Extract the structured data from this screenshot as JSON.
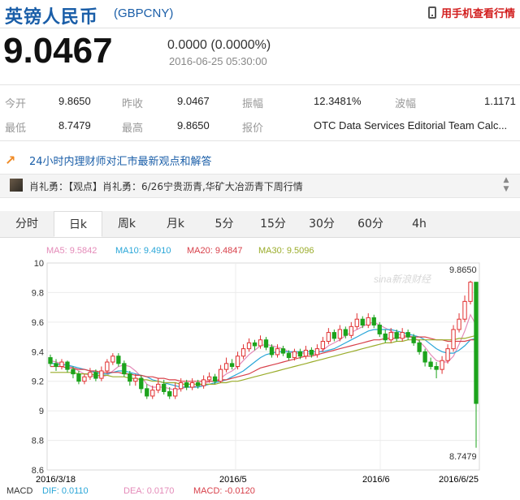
{
  "header": {
    "title": "英镑人民币",
    "code": "(GBPCNY)",
    "mobile_link": "用手机查看行情",
    "icon": "phone-icon"
  },
  "quote": {
    "price": "9.0467",
    "change": "0.0000 (0.0000%)",
    "timestamp": "2016-06-25 05:30:00"
  },
  "stats": [
    {
      "label": "今开",
      "value": "9.8650"
    },
    {
      "label": "昨收",
      "value": "9.0467"
    },
    {
      "label": "振幅",
      "value": "12.3481%"
    },
    {
      "label": "波幅",
      "value": "1.1171"
    },
    {
      "label": "最低",
      "value": "8.7479"
    },
    {
      "label": "最高",
      "value": "9.8650"
    },
    {
      "label": "报价",
      "value": "OTC Data Services Editorial Team Calc..."
    }
  ],
  "news": {
    "headline": "24小时内理财师对汇市最新观点和解答",
    "item": "肖礼勇：【观点】肖礼勇：6/26宁贵沥青,华矿大冶沥青下周行情"
  },
  "tabs": [
    "分时",
    "日k",
    "周k",
    "月k",
    "5分",
    "15分",
    "30分",
    "60分",
    "4h"
  ],
  "active_tab": "日k",
  "chart_data": {
    "type": "candlestick",
    "ylim": [
      8.6,
      10.0
    ],
    "y_ticks": [
      "10",
      "9.8",
      "9.6",
      "9.4",
      "9.2",
      "9",
      "8.8",
      "8.6"
    ],
    "x_tick_labels": [
      "2016/3/18",
      "2016/5",
      "2016/6",
      "2016/6/25"
    ],
    "ma_legend": [
      {
        "label": "MA5: 9.5842",
        "color": "#e48ab8"
      },
      {
        "label": "MA10: 9.4910",
        "color": "#29a6d8"
      },
      {
        "label": "MA20: 9.4847",
        "color": "#d8404a"
      },
      {
        "label": "MA30: 9.5096",
        "color": "#9aac2a"
      }
    ],
    "high_label": "9.8650",
    "low_label": "8.7479",
    "watermark": "sina新浪财经",
    "macd": {
      "name": "MACD",
      "dif": "DIF: 0.0110",
      "dea": "DEA: 0.0170",
      "macd": "MACD: -0.0120"
    },
    "colors": {
      "up": "#e03030",
      "down": "#1ca31c"
    },
    "candles": [
      [
        9.36,
        9.32,
        9.38,
        9.3
      ],
      [
        9.32,
        9.3,
        9.35,
        9.27
      ],
      [
        9.3,
        9.33,
        9.35,
        9.28
      ],
      [
        9.33,
        9.28,
        9.34,
        9.26
      ],
      [
        9.28,
        9.25,
        9.3,
        9.22
      ],
      [
        9.25,
        9.2,
        9.27,
        9.18
      ],
      [
        9.2,
        9.23,
        9.25,
        9.18
      ],
      [
        9.23,
        9.26,
        9.29,
        9.21
      ],
      [
        9.26,
        9.22,
        9.28,
        9.2
      ],
      [
        9.22,
        9.27,
        9.3,
        9.2
      ],
      [
        9.27,
        9.33,
        9.35,
        9.25
      ],
      [
        9.33,
        9.37,
        9.39,
        9.31
      ],
      [
        9.37,
        9.32,
        9.39,
        9.3
      ],
      [
        9.32,
        9.25,
        9.34,
        9.23
      ],
      [
        9.25,
        9.2,
        9.27,
        9.17
      ],
      [
        9.2,
        9.22,
        9.25,
        9.17
      ],
      [
        9.22,
        9.15,
        9.24,
        9.12
      ],
      [
        9.15,
        9.1,
        9.18,
        9.08
      ],
      [
        9.1,
        9.14,
        9.17,
        9.08
      ],
      [
        9.14,
        9.18,
        9.22,
        9.12
      ],
      [
        9.18,
        9.13,
        9.21,
        9.11
      ],
      [
        9.13,
        9.1,
        9.16,
        9.08
      ],
      [
        9.1,
        9.15,
        9.19,
        9.08
      ],
      [
        9.15,
        9.19,
        9.22,
        9.13
      ],
      [
        9.19,
        9.16,
        9.21,
        9.14
      ],
      [
        9.16,
        9.19,
        9.22,
        9.14
      ],
      [
        9.19,
        9.17,
        9.21,
        9.15
      ],
      [
        9.17,
        9.21,
        9.24,
        9.15
      ],
      [
        9.21,
        9.23,
        9.26,
        9.19
      ],
      [
        9.23,
        9.2,
        9.25,
        9.18
      ],
      [
        9.2,
        9.28,
        9.31,
        9.19
      ],
      [
        9.28,
        9.32,
        9.36,
        9.26
      ],
      [
        9.32,
        9.3,
        9.35,
        9.28
      ],
      [
        9.3,
        9.37,
        9.4,
        9.28
      ],
      [
        9.37,
        9.42,
        9.45,
        9.35
      ],
      [
        9.42,
        9.46,
        9.49,
        9.4
      ],
      [
        9.46,
        9.44,
        9.48,
        9.41
      ],
      [
        9.44,
        9.48,
        9.51,
        9.42
      ],
      [
        9.48,
        9.43,
        9.5,
        9.41
      ],
      [
        9.43,
        9.38,
        9.45,
        9.36
      ],
      [
        9.38,
        9.42,
        9.45,
        9.36
      ],
      [
        9.42,
        9.39,
        9.44,
        9.37
      ],
      [
        9.39,
        9.36,
        9.41,
        9.34
      ],
      [
        9.36,
        9.4,
        9.42,
        9.34
      ],
      [
        9.4,
        9.37,
        9.42,
        9.35
      ],
      [
        9.37,
        9.41,
        9.44,
        9.35
      ],
      [
        9.41,
        9.38,
        9.43,
        9.36
      ],
      [
        9.38,
        9.42,
        9.45,
        9.36
      ],
      [
        9.42,
        9.47,
        9.5,
        9.4
      ],
      [
        9.47,
        9.53,
        9.56,
        9.45
      ],
      [
        9.53,
        9.49,
        9.55,
        9.47
      ],
      [
        9.49,
        9.55,
        9.58,
        9.47
      ],
      [
        9.55,
        9.51,
        9.57,
        9.49
      ],
      [
        9.51,
        9.57,
        9.6,
        9.49
      ],
      [
        9.57,
        9.62,
        9.66,
        9.55
      ],
      [
        9.62,
        9.58,
        9.64,
        9.56
      ],
      [
        9.58,
        9.63,
        9.66,
        9.56
      ],
      [
        9.63,
        9.58,
        9.65,
        9.56
      ],
      [
        9.58,
        9.52,
        9.6,
        9.5
      ],
      [
        9.52,
        9.48,
        9.55,
        9.46
      ],
      [
        9.48,
        9.53,
        9.56,
        9.46
      ],
      [
        9.53,
        9.49,
        9.55,
        9.47
      ],
      [
        9.49,
        9.53,
        9.56,
        9.47
      ],
      [
        9.53,
        9.5,
        9.55,
        9.48
      ],
      [
        9.5,
        9.46,
        9.52,
        9.44
      ],
      [
        9.46,
        9.4,
        9.48,
        9.38
      ],
      [
        9.4,
        9.33,
        9.42,
        9.3
      ],
      [
        9.33,
        9.3,
        9.36,
        9.28
      ],
      [
        9.3,
        9.28,
        9.33,
        9.22
      ],
      [
        9.28,
        9.34,
        9.37,
        9.25
      ],
      [
        9.34,
        9.42,
        9.45,
        9.32
      ],
      [
        9.42,
        9.55,
        9.58,
        9.4
      ],
      [
        9.55,
        9.62,
        9.66,
        9.53
      ],
      [
        9.62,
        9.74,
        9.78,
        9.6
      ],
      [
        9.74,
        9.87,
        9.88,
        9.72
      ],
      [
        9.87,
        9.05,
        9.87,
        8.75
      ]
    ],
    "ma_lines": [
      [
        9.34,
        9.33,
        9.32,
        9.31,
        9.29,
        9.27,
        9.25,
        9.24,
        9.23,
        9.23,
        9.24,
        9.27,
        9.3,
        9.31,
        9.3,
        9.27,
        9.23,
        9.18,
        9.16,
        9.16,
        9.16,
        9.15,
        9.14,
        9.15,
        9.16,
        9.16,
        9.17,
        9.18,
        9.2,
        9.2,
        9.22,
        9.25,
        9.27,
        9.3,
        9.34,
        9.38,
        9.41,
        9.44,
        9.45,
        9.44,
        9.43,
        9.42,
        9.4,
        9.39,
        9.39,
        9.39,
        9.38,
        9.39,
        9.41,
        9.44,
        9.46,
        9.48,
        9.51,
        9.53,
        9.55,
        9.57,
        9.59,
        9.6,
        9.58,
        9.56,
        9.54,
        9.52,
        9.51,
        9.51,
        9.5,
        9.47,
        9.43,
        9.38,
        9.34,
        9.33,
        9.33,
        9.37,
        9.45,
        9.54,
        9.65,
        9.58
      ],
      [
        9.32,
        9.32,
        9.31,
        9.31,
        9.3,
        9.29,
        9.28,
        9.27,
        9.26,
        9.25,
        9.25,
        9.26,
        9.27,
        9.27,
        9.26,
        9.25,
        9.24,
        9.23,
        9.21,
        9.2,
        9.19,
        9.18,
        9.17,
        9.16,
        9.16,
        9.16,
        9.16,
        9.17,
        9.18,
        9.19,
        9.2,
        9.21,
        9.23,
        9.25,
        9.27,
        9.3,
        9.33,
        9.36,
        9.38,
        9.39,
        9.4,
        9.4,
        9.4,
        9.4,
        9.4,
        9.4,
        9.4,
        9.4,
        9.4,
        9.41,
        9.42,
        9.44,
        9.46,
        9.48,
        9.5,
        9.52,
        9.54,
        9.55,
        9.55,
        9.55,
        9.55,
        9.54,
        9.53,
        9.52,
        9.51,
        9.5,
        9.48,
        9.45,
        9.42,
        9.4,
        9.39,
        9.39,
        9.41,
        9.44,
        9.48,
        9.49
      ],
      [
        9.3,
        9.3,
        9.3,
        9.29,
        9.29,
        9.28,
        9.28,
        9.27,
        9.27,
        9.26,
        9.26,
        9.26,
        9.26,
        9.25,
        9.25,
        9.24,
        9.24,
        9.23,
        9.23,
        9.22,
        9.22,
        9.21,
        9.21,
        9.2,
        9.2,
        9.2,
        9.2,
        9.2,
        9.2,
        9.2,
        9.21,
        9.21,
        9.22,
        9.23,
        9.24,
        9.25,
        9.27,
        9.29,
        9.3,
        9.31,
        9.32,
        9.33,
        9.34,
        9.35,
        9.36,
        9.37,
        9.37,
        9.38,
        9.39,
        9.4,
        9.41,
        9.42,
        9.43,
        9.44,
        9.45,
        9.46,
        9.47,
        9.48,
        9.48,
        9.49,
        9.49,
        9.49,
        9.5,
        9.5,
        9.5,
        9.5,
        9.5,
        9.49,
        9.48,
        9.48,
        9.47,
        9.47,
        9.47,
        9.47,
        9.48,
        9.48
      ],
      [
        9.26,
        9.26,
        9.26,
        9.26,
        9.26,
        9.25,
        9.25,
        9.25,
        9.24,
        9.24,
        9.24,
        9.23,
        9.23,
        9.23,
        9.22,
        9.22,
        9.21,
        9.21,
        9.2,
        9.2,
        9.19,
        9.19,
        9.19,
        9.18,
        9.18,
        9.18,
        9.18,
        9.18,
        9.18,
        9.18,
        9.19,
        9.19,
        9.2,
        9.2,
        9.21,
        9.22,
        9.23,
        9.24,
        9.25,
        9.26,
        9.27,
        9.28,
        9.29,
        9.3,
        9.31,
        9.32,
        9.33,
        9.34,
        9.35,
        9.36,
        9.37,
        9.38,
        9.39,
        9.4,
        9.41,
        9.42,
        9.43,
        9.44,
        9.45,
        9.46,
        9.46,
        9.47,
        9.47,
        9.48,
        9.48,
        9.48,
        9.48,
        9.48,
        9.48,
        9.48,
        9.48,
        9.48,
        9.49,
        9.49,
        9.5,
        9.51
      ]
    ]
  }
}
